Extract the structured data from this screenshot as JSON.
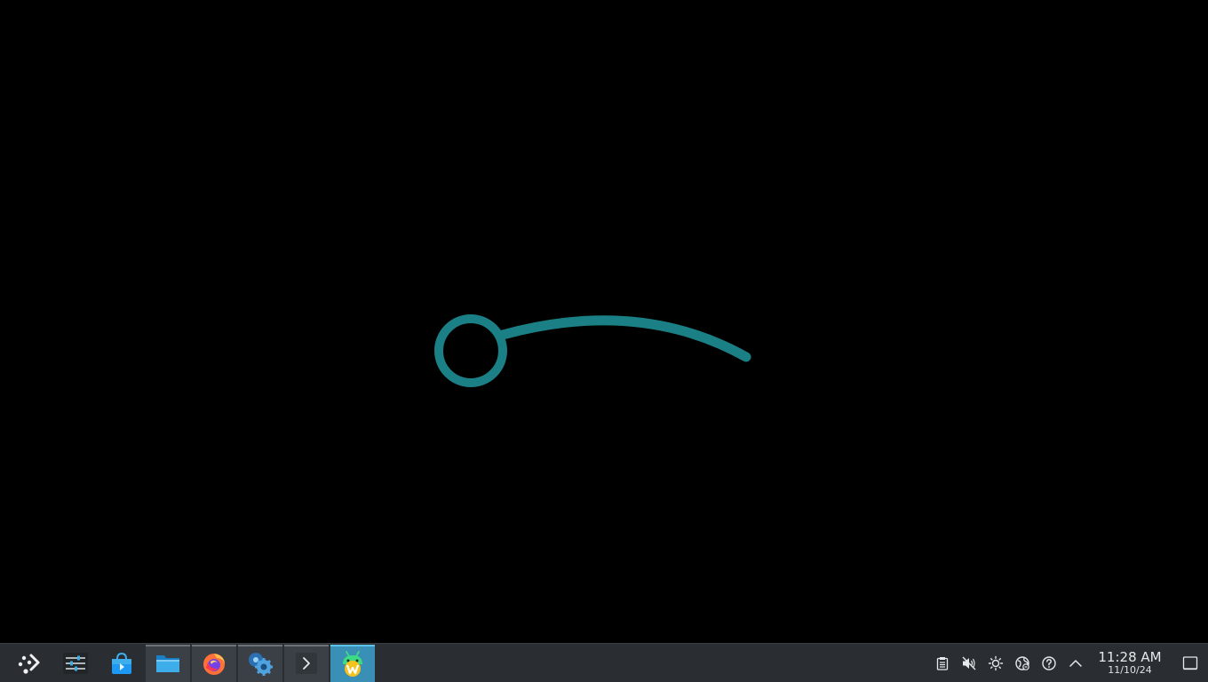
{
  "desktop": {
    "background": "#000000",
    "splash": {
      "icon": "loading-spinner-icon",
      "color": "#1b8086"
    }
  },
  "taskbar": {
    "background": "#2a2e32",
    "launcher": {
      "icon": "application-launcher-icon"
    },
    "items": [
      {
        "icon": "system-settings-sliders-icon",
        "state": "idle"
      },
      {
        "icon": "discover-store-icon",
        "state": "idle"
      },
      {
        "icon": "file-manager-folder-icon",
        "state": "running"
      },
      {
        "icon": "firefox-icon",
        "state": "running"
      },
      {
        "icon": "system-config-gear-icon",
        "state": "running"
      },
      {
        "icon": "terminal-icon",
        "state": "running"
      },
      {
        "icon": "waydroid-android-icon",
        "state": "active"
      }
    ],
    "tray": {
      "icons": [
        "clipboard-icon",
        "volume-muted-icon",
        "brightness-icon",
        "network-globe-icon",
        "help-icon",
        "chevron-up-icon"
      ],
      "clock": {
        "time": "11:28 AM",
        "date": "11/10/24"
      },
      "show_desktop": "show-desktop-icon"
    }
  }
}
